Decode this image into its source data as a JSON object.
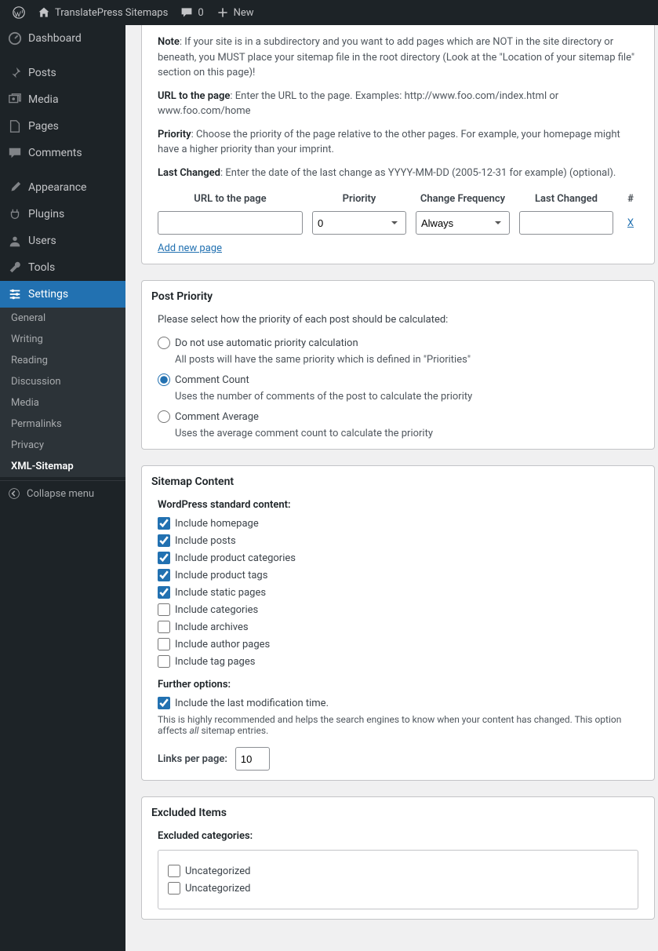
{
  "topbar": {
    "site": "TranslatePress Sitemaps",
    "comments": "0",
    "new": "New"
  },
  "menu": {
    "dashboard": "Dashboard",
    "posts": "Posts",
    "media": "Media",
    "pages": "Pages",
    "comments": "Comments",
    "appearance": "Appearance",
    "plugins": "Plugins",
    "users": "Users",
    "tools": "Tools",
    "settings": "Settings",
    "collapse": "Collapse menu"
  },
  "submenu": {
    "general": "General",
    "writing": "Writing",
    "reading": "Reading",
    "discussion": "Discussion",
    "media": "Media",
    "permalinks": "Permalinks",
    "privacy": "Privacy",
    "xml": "XML-Sitemap"
  },
  "intro": {
    "note_b": "Note",
    "note": ": If your site is in a subdirectory and you want to add pages which are NOT in the site directory or beneath, you MUST place your sitemap file in the root directory (Look at the \"Location of your sitemap file\" section on this page)!",
    "url_b": "URL to the page",
    "url": ": Enter the URL to the page. Examples: http://www.foo.com/index.html or www.foo.com/home",
    "pri_b": "Priority",
    "pri": ": Choose the priority of the page relative to the other pages. For example, your homepage might have a higher priority than your imprint.",
    "lc_b": "Last Changed",
    "lc": ": Enter the date of the last change as YYYY-MM-DD (2005-12-31 for example) (optional)."
  },
  "table": {
    "h_url": "URL to the page",
    "h_pri": "Priority",
    "h_freq": "Change Frequency",
    "h_last": "Last Changed",
    "h_x": "#",
    "pri_val": "0",
    "freq_val": "Always",
    "del": "X",
    "addnew": "Add new page"
  },
  "postpri": {
    "title": "Post Priority",
    "lead": "Please select how the priority of each post should be calculated:",
    "opt1": "Do not use automatic priority calculation",
    "opt1_sub": "All posts will have the same priority which is defined in \"Priorities\"",
    "opt2": "Comment Count",
    "opt2_sub": "Uses the number of comments of the post to calculate the priority",
    "opt3": "Comment Average",
    "opt3_sub": "Uses the average comment count to calculate the priority"
  },
  "sitemap": {
    "title": "Sitemap Content",
    "std_head": "WordPress standard content:",
    "items": [
      {
        "label": "Include homepage",
        "checked": true
      },
      {
        "label": "Include posts",
        "checked": true
      },
      {
        "label": "Include product categories",
        "checked": true
      },
      {
        "label": "Include product tags",
        "checked": true
      },
      {
        "label": "Include static pages",
        "checked": true
      },
      {
        "label": "Include categories",
        "checked": false
      },
      {
        "label": "Include archives",
        "checked": false
      },
      {
        "label": "Include author pages",
        "checked": false
      },
      {
        "label": "Include tag pages",
        "checked": false
      }
    ],
    "further_head": "Further options:",
    "lastmod": "Include the last modification time.",
    "lastmod_note_a": "This is highly recommended and helps the search engines to know when your content has changed. This option affects ",
    "lastmod_note_i": "all",
    "lastmod_note_b": " sitemap entries.",
    "links_label": "Links per page:",
    "links_val": "10"
  },
  "excluded": {
    "title": "Excluded Items",
    "cat_head": "Excluded categories:",
    "cats": [
      {
        "label": "Uncategorized",
        "checked": false
      },
      {
        "label": "Uncategorized",
        "checked": false
      }
    ]
  }
}
